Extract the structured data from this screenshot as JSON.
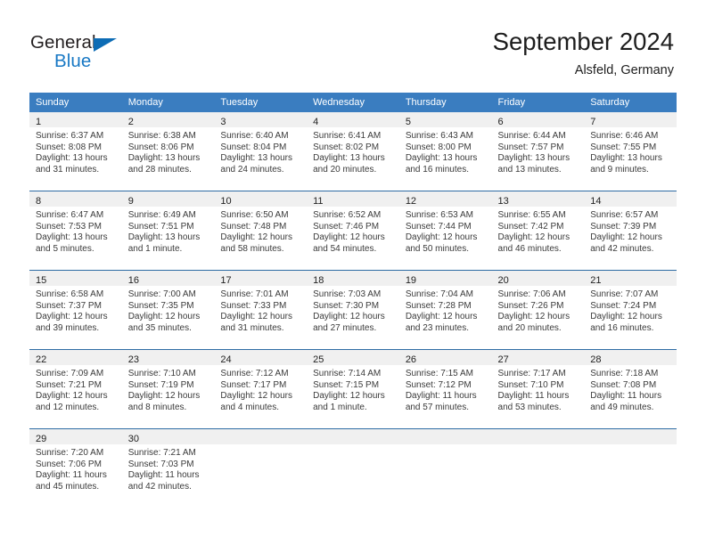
{
  "brand": {
    "name_part1": "General",
    "name_part2": "Blue",
    "accent_color": "#1878c4",
    "triangle_color": "#0d6cb5"
  },
  "header": {
    "title": "September 2024",
    "location": "Alsfeld, Germany"
  },
  "calendar": {
    "header_bg": "#3a7dc0",
    "daynum_band_bg": "#f0f0f0",
    "row_separator_color": "#2e6ca4",
    "weekday_headers": [
      "Sunday",
      "Monday",
      "Tuesday",
      "Wednesday",
      "Thursday",
      "Friday",
      "Saturday"
    ],
    "weeks": [
      [
        {
          "day": "1",
          "sunrise": "Sunrise: 6:37 AM",
          "sunset": "Sunset: 8:08 PM",
          "daylight": "Daylight: 13 hours and 31 minutes."
        },
        {
          "day": "2",
          "sunrise": "Sunrise: 6:38 AM",
          "sunset": "Sunset: 8:06 PM",
          "daylight": "Daylight: 13 hours and 28 minutes."
        },
        {
          "day": "3",
          "sunrise": "Sunrise: 6:40 AM",
          "sunset": "Sunset: 8:04 PM",
          "daylight": "Daylight: 13 hours and 24 minutes."
        },
        {
          "day": "4",
          "sunrise": "Sunrise: 6:41 AM",
          "sunset": "Sunset: 8:02 PM",
          "daylight": "Daylight: 13 hours and 20 minutes."
        },
        {
          "day": "5",
          "sunrise": "Sunrise: 6:43 AM",
          "sunset": "Sunset: 8:00 PM",
          "daylight": "Daylight: 13 hours and 16 minutes."
        },
        {
          "day": "6",
          "sunrise": "Sunrise: 6:44 AM",
          "sunset": "Sunset: 7:57 PM",
          "daylight": "Daylight: 13 hours and 13 minutes."
        },
        {
          "day": "7",
          "sunrise": "Sunrise: 6:46 AM",
          "sunset": "Sunset: 7:55 PM",
          "daylight": "Daylight: 13 hours and 9 minutes."
        }
      ],
      [
        {
          "day": "8",
          "sunrise": "Sunrise: 6:47 AM",
          "sunset": "Sunset: 7:53 PM",
          "daylight": "Daylight: 13 hours and 5 minutes."
        },
        {
          "day": "9",
          "sunrise": "Sunrise: 6:49 AM",
          "sunset": "Sunset: 7:51 PM",
          "daylight": "Daylight: 13 hours and 1 minute."
        },
        {
          "day": "10",
          "sunrise": "Sunrise: 6:50 AM",
          "sunset": "Sunset: 7:48 PM",
          "daylight": "Daylight: 12 hours and 58 minutes."
        },
        {
          "day": "11",
          "sunrise": "Sunrise: 6:52 AM",
          "sunset": "Sunset: 7:46 PM",
          "daylight": "Daylight: 12 hours and 54 minutes."
        },
        {
          "day": "12",
          "sunrise": "Sunrise: 6:53 AM",
          "sunset": "Sunset: 7:44 PM",
          "daylight": "Daylight: 12 hours and 50 minutes."
        },
        {
          "day": "13",
          "sunrise": "Sunrise: 6:55 AM",
          "sunset": "Sunset: 7:42 PM",
          "daylight": "Daylight: 12 hours and 46 minutes."
        },
        {
          "day": "14",
          "sunrise": "Sunrise: 6:57 AM",
          "sunset": "Sunset: 7:39 PM",
          "daylight": "Daylight: 12 hours and 42 minutes."
        }
      ],
      [
        {
          "day": "15",
          "sunrise": "Sunrise: 6:58 AM",
          "sunset": "Sunset: 7:37 PM",
          "daylight": "Daylight: 12 hours and 39 minutes."
        },
        {
          "day": "16",
          "sunrise": "Sunrise: 7:00 AM",
          "sunset": "Sunset: 7:35 PM",
          "daylight": "Daylight: 12 hours and 35 minutes."
        },
        {
          "day": "17",
          "sunrise": "Sunrise: 7:01 AM",
          "sunset": "Sunset: 7:33 PM",
          "daylight": "Daylight: 12 hours and 31 minutes."
        },
        {
          "day": "18",
          "sunrise": "Sunrise: 7:03 AM",
          "sunset": "Sunset: 7:30 PM",
          "daylight": "Daylight: 12 hours and 27 minutes."
        },
        {
          "day": "19",
          "sunrise": "Sunrise: 7:04 AM",
          "sunset": "Sunset: 7:28 PM",
          "daylight": "Daylight: 12 hours and 23 minutes."
        },
        {
          "day": "20",
          "sunrise": "Sunrise: 7:06 AM",
          "sunset": "Sunset: 7:26 PM",
          "daylight": "Daylight: 12 hours and 20 minutes."
        },
        {
          "day": "21",
          "sunrise": "Sunrise: 7:07 AM",
          "sunset": "Sunset: 7:24 PM",
          "daylight": "Daylight: 12 hours and 16 minutes."
        }
      ],
      [
        {
          "day": "22",
          "sunrise": "Sunrise: 7:09 AM",
          "sunset": "Sunset: 7:21 PM",
          "daylight": "Daylight: 12 hours and 12 minutes."
        },
        {
          "day": "23",
          "sunrise": "Sunrise: 7:10 AM",
          "sunset": "Sunset: 7:19 PM",
          "daylight": "Daylight: 12 hours and 8 minutes."
        },
        {
          "day": "24",
          "sunrise": "Sunrise: 7:12 AM",
          "sunset": "Sunset: 7:17 PM",
          "daylight": "Daylight: 12 hours and 4 minutes."
        },
        {
          "day": "25",
          "sunrise": "Sunrise: 7:14 AM",
          "sunset": "Sunset: 7:15 PM",
          "daylight": "Daylight: 12 hours and 1 minute."
        },
        {
          "day": "26",
          "sunrise": "Sunrise: 7:15 AM",
          "sunset": "Sunset: 7:12 PM",
          "daylight": "Daylight: 11 hours and 57 minutes."
        },
        {
          "day": "27",
          "sunrise": "Sunrise: 7:17 AM",
          "sunset": "Sunset: 7:10 PM",
          "daylight": "Daylight: 11 hours and 53 minutes."
        },
        {
          "day": "28",
          "sunrise": "Sunrise: 7:18 AM",
          "sunset": "Sunset: 7:08 PM",
          "daylight": "Daylight: 11 hours and 49 minutes."
        }
      ],
      [
        {
          "day": "29",
          "sunrise": "Sunrise: 7:20 AM",
          "sunset": "Sunset: 7:06 PM",
          "daylight": "Daylight: 11 hours and 45 minutes."
        },
        {
          "day": "30",
          "sunrise": "Sunrise: 7:21 AM",
          "sunset": "Sunset: 7:03 PM",
          "daylight": "Daylight: 11 hours and 42 minutes."
        },
        {
          "day": "",
          "sunrise": "",
          "sunset": "",
          "daylight": ""
        },
        {
          "day": "",
          "sunrise": "",
          "sunset": "",
          "daylight": ""
        },
        {
          "day": "",
          "sunrise": "",
          "sunset": "",
          "daylight": ""
        },
        {
          "day": "",
          "sunrise": "",
          "sunset": "",
          "daylight": ""
        },
        {
          "day": "",
          "sunrise": "",
          "sunset": "",
          "daylight": ""
        }
      ]
    ]
  }
}
